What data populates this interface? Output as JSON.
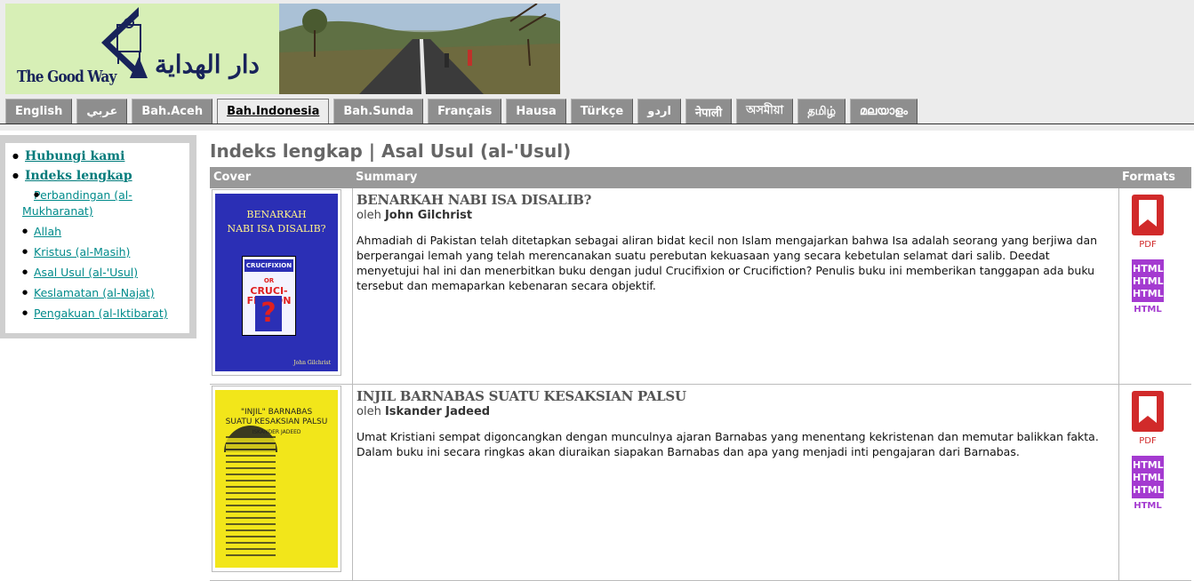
{
  "header": {
    "logo_text_en": "The Good Way",
    "logo_text_ar": "دار الهداية"
  },
  "tabs": [
    {
      "label": "English"
    },
    {
      "label": "عربي"
    },
    {
      "label": "Bah.Aceh"
    },
    {
      "label": "Bah.Indonesia",
      "active": true
    },
    {
      "label": "Bah.Sunda"
    },
    {
      "label": "Français"
    },
    {
      "label": "Hausa"
    },
    {
      "label": "Türkçe"
    },
    {
      "label": "اردو"
    },
    {
      "label": "नेपाली"
    },
    {
      "label": "অসমীয়া"
    },
    {
      "label": "தமிழ்"
    },
    {
      "label": "മലയാളം"
    }
  ],
  "sidebar": {
    "top_links": [
      "Hubungi kami",
      "Indeks lengkap"
    ],
    "sub_links": [
      "Perbandingan (al-Mukharanat)",
      "Allah",
      "Kristus (al-Masih)",
      "Asal Usul (al-'Usul)",
      "Keslamatan (al-Najat)",
      "Pengakuan (al-Iktibarat)"
    ]
  },
  "main": {
    "title": "Indeks lengkap | Asal Usul (al-'Usul)",
    "columns": {
      "cover": "Cover",
      "summary": "Summary",
      "formats": "Formats"
    },
    "books": [
      {
        "title": "BENARKAH NABI ISA DISALIB?",
        "by": "oleh",
        "author": "John Gilchrist",
        "description": "Ahmadiah di Pakistan telah ditetapkan sebagai aliran bidat kecil non Islam mengajarkan bahwa Isa adalah seorang yang berjiwa dan berperangai lemah yang telah merencanakan suatu perebutan kekuasaan yang secara kebetulan selamat dari salib. Deedat menyetujui hal ini dan menerbitkan buku dengan judul Crucifixion or Crucifiction? Penulis buku ini memberikan tanggapan ada buku tersebut dan memaparkan kebenaran secara objektif.",
        "cover": {
          "title_line1": "BENARKAH",
          "title_line2": "NABI ISA DISALIB?",
          "box_top": "CRUCIFIXION",
          "box_or": "OR",
          "box_main1": "CRUCI-",
          "box_main2": "FICTION",
          "box_q": "?",
          "author": "John Gilchrist"
        },
        "formats": [
          "PDF",
          "HTML"
        ]
      },
      {
        "title": "INJIL BARNABAS SUATU KESAKSIAN PALSU",
        "by": "oleh",
        "author": "Iskander Jadeed",
        "description": "Umat Kristiani sempat digoncangkan dengan munculnya ajaran Barnabas yang menentang kekristenan dan memutar balikkan fakta. Dalam buku ini secara ringkas akan diuraikan siapakan Barnabas dan apa yang menjadi inti pengajaran dari Barnabas.",
        "cover": {
          "title_line1": "\"INJIL\" BARNABAS",
          "title_line2": "SUATU KESAKSIAN PALSU",
          "author": "ISKANDER JADEED"
        },
        "formats": [
          "PDF",
          "HTML"
        ]
      }
    ]
  },
  "colors": {
    "header_bg": "#ececec",
    "tab_bg": "#8e8e8e",
    "link": "#007b7b",
    "table_header": "#999999",
    "pdf_red": "#d12a2a",
    "html_purple": "#a43ad0"
  }
}
